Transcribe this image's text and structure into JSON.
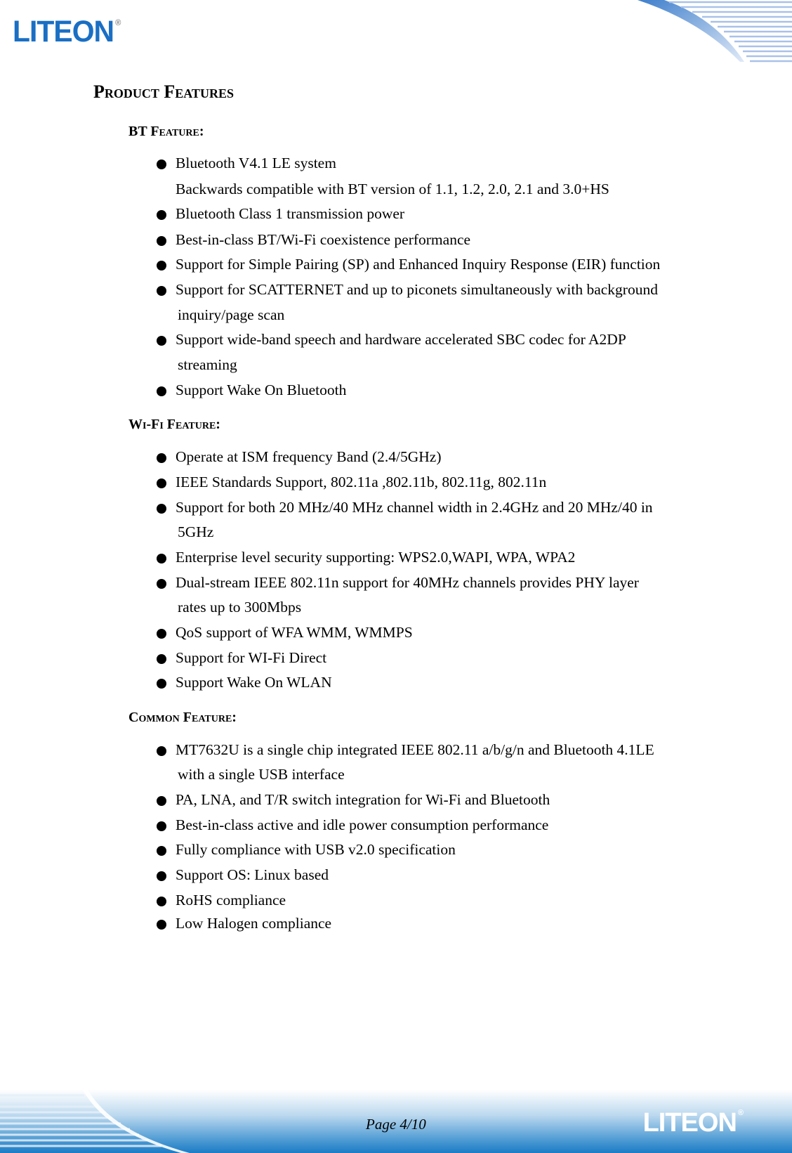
{
  "header": {
    "logo_text": "LITEON",
    "logo_mark": "®"
  },
  "page_title": "Product Features",
  "sections": {
    "bt": {
      "title": "BT Feature:",
      "items": [
        "Bluetooth V4.1 LE system",
        "Backwards compatible with BT version of 1.1, 1.2, 2.0, 2.1 and 3.0+HS",
        "Bluetooth Class 1 transmission power",
        "Best-in-class BT/Wi-Fi coexistence performance",
        "Support for Simple Pairing (SP) and Enhanced Inquiry Response (EIR) function",
        "Support for SCATTERNET and up to piconets simultaneously with background",
        "inquiry/page scan",
        "Support wide-band speech and hardware accelerated SBC codec for A2DP",
        "streaming",
        "Support Wake On Bluetooth"
      ]
    },
    "wifi": {
      "title": "Wi-Fi Feature:",
      "items": [
        "Operate at ISM frequency Band (2.4/5GHz)",
        "IEEE Standards Support, 802.11a ,802.11b, 802.11g, 802.11n",
        "Support for both 20 MHz/40 MHz channel width in 2.4GHz and 20 MHz/40 in",
        "5GHz",
        "Enterprise level security supporting: WPS2.0,WAPI, WPA, WPA2",
        "Dual-stream IEEE 802.11n support for 40MHz channels provides PHY layer",
        "rates up to 300Mbps",
        "QoS support of WFA WMM, WMMPS",
        "Support for WI-Fi Direct",
        "Support Wake On WLAN"
      ]
    },
    "common": {
      "title": "Common Feature:",
      "items": [
        "MT7632U is a single chip integrated IEEE 802.11 a/b/g/n and Bluetooth 4.1LE",
        "with a single USB interface",
        "PA, LNA, and T/R switch integration for Wi-Fi and Bluetooth",
        "Best-in-class active and idle power consumption performance",
        "Fully compliance with USB v2.0 specification",
        "Support OS: Linux based",
        "RoHS compliance",
        "Low Halogen compliance"
      ]
    }
  },
  "footer": {
    "page_label": "Page 4/10",
    "logo_text": "LITEON",
    "logo_mark": "®"
  },
  "colors": {
    "brand_blue": "#1a6fc4",
    "footer_blue": "#1b7cc5"
  }
}
